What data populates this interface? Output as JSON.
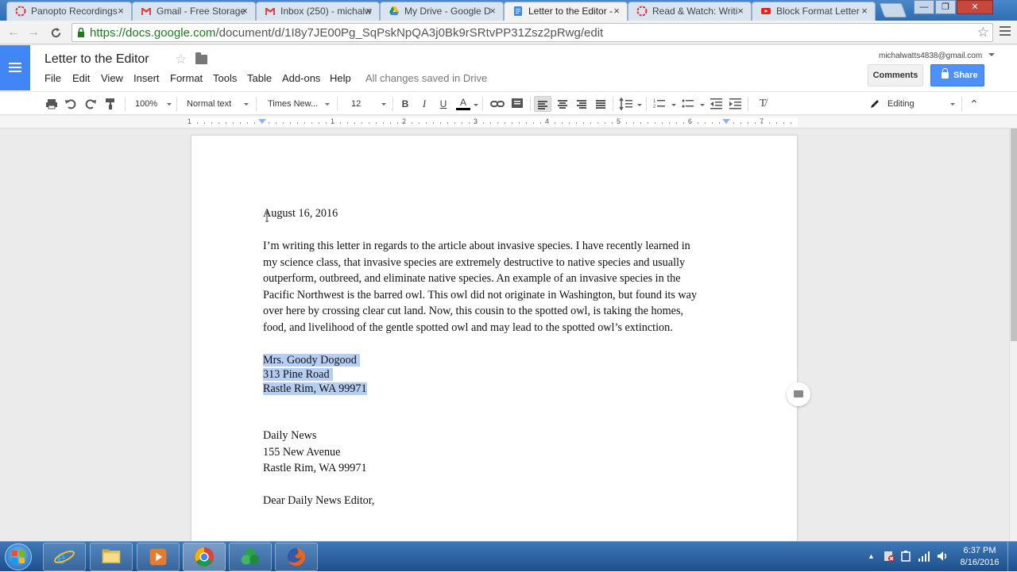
{
  "browser": {
    "tabs": [
      {
        "title": "Panopto Recordings",
        "close": "×"
      },
      {
        "title": "Gmail - Free Storage",
        "close": "×"
      },
      {
        "title": "Inbox (250) - michalw",
        "close": "×"
      },
      {
        "title": "My Drive - Google D",
        "close": "×"
      },
      {
        "title": "Letter to the Editor -",
        "close": "×"
      },
      {
        "title": "Read & Watch: Writi",
        "close": "×"
      },
      {
        "title": "Block Format Letter",
        "close": "×"
      }
    ],
    "url_host": "https://docs.google.com",
    "url_path": "/document/d/1I8y7JE00Pg_SqPskNpQA3j0Bk9rSRtvPP31Zsz2pRwg/edit",
    "nav_back": "←",
    "nav_forward": "→",
    "nav_reload": "C",
    "bookmark_star": "☆",
    "window_minimize": "—",
    "window_restore": "❐",
    "window_close": "✕"
  },
  "docs": {
    "title": "Letter to the Editor",
    "title_star": "☆",
    "menus": [
      "File",
      "Edit",
      "View",
      "Insert",
      "Format",
      "Tools",
      "Table",
      "Add-ons",
      "Help"
    ],
    "save_status": "All changes saved in Drive",
    "account": "michalwatts4838@gmail.com",
    "comments_label": "Comments",
    "share_label": "Share"
  },
  "format_toolbar": {
    "zoom": "100%",
    "style": "Normal text",
    "font": "Times New...",
    "size": "12",
    "bold": "B",
    "italic": "I",
    "underline": "U",
    "text_color": "A",
    "clear_format": "T̸",
    "mode": "Editing",
    "collapse": "⌃"
  },
  "ruler": {
    "numbers": [
      "1",
      "1",
      "2",
      "3",
      "4",
      "5",
      "6",
      "7"
    ]
  },
  "document": {
    "date": "August 16, 2016",
    "paragraph_lines": [
      "I’m writing this letter in regards to the article about invasive species. I have recently learned in",
      "my science class, that invasive species are extremely destructive to native species and usually",
      "outperform, outbreed, and eliminate native species. An example  of an invasive species in the",
      "Pacific Northwest is the barred owl. This owl did not originate in Washington, but found its way",
      "over here by crossing clear cut land. Now, this cousin to the spotted owl, is taking the homes,",
      "food, and livelihood of the gentle spotted owl and may lead to the spotted owl’s extinction."
    ],
    "sender_address": [
      "Mrs. Goody Dogood",
      "313 Pine Road",
      "Rastle Rim, WA 99971"
    ],
    "recipient_address": [
      "Daily News",
      "155 New Avenue",
      "Rastle Rim, WA 99971"
    ],
    "salutation": "Dear Daily News Editor,"
  },
  "taskbar": {
    "time": "6:37 PM",
    "date": "8/16/2016",
    "tray_arrow": "▲"
  },
  "colors": {
    "docs_blue": "#4285f4",
    "share_blue": "#4d90fe",
    "selection": "#b5cef2",
    "url_green": "#1a7d1a"
  }
}
